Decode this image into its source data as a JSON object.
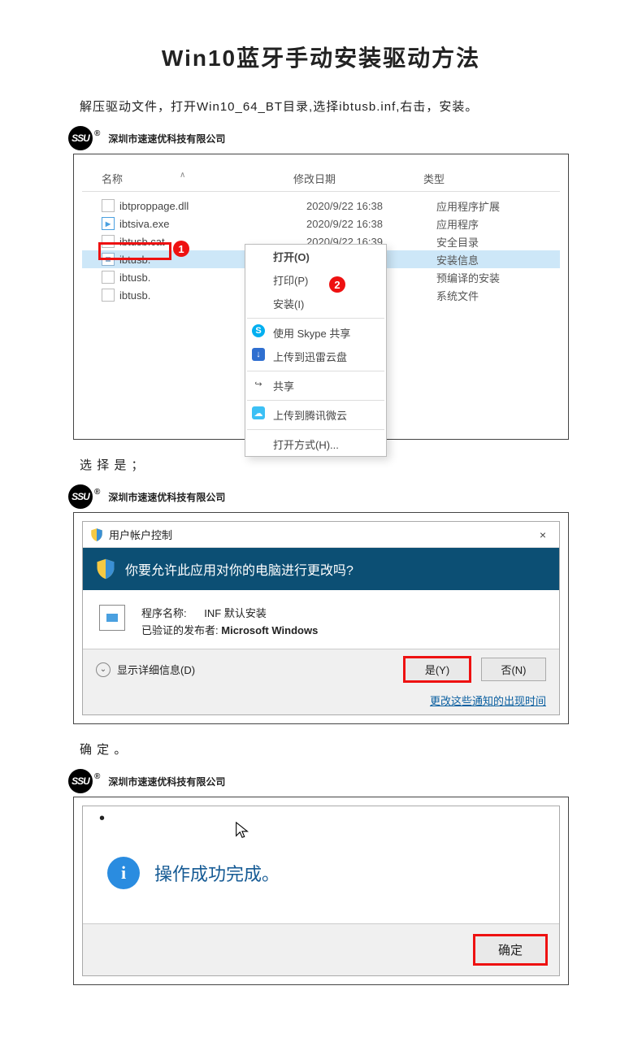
{
  "title": "Win10蓝牙手动安装驱动方法",
  "intro": "解压驱动文件，打开Win10_64_BT目录,选择ibtusb.inf,右击，安装。",
  "watermark": {
    "logo": "SSU",
    "company": "深圳市速速优科技有限公司",
    "reg": "®"
  },
  "explorer": {
    "columns": {
      "name": "名称",
      "date": "修改日期",
      "type": "类型"
    },
    "files": [
      {
        "name": "ibtproppage.dll",
        "date": "2020/9/22 16:38",
        "type": "应用程序扩展"
      },
      {
        "name": "ibtsiva.exe",
        "date": "2020/9/22 16:38",
        "type": "应用程序"
      },
      {
        "name": "ibtusb.cat",
        "date": "2020/9/22 16:39",
        "type": "安全目录"
      },
      {
        "name": "ibtusb.",
        "date": "",
        "type": "安装信息",
        "selected": true
      },
      {
        "name": "ibtusb.",
        "date": "",
        "type": "预编译的安装"
      },
      {
        "name": "ibtusb.",
        "date": "",
        "type": "系统文件"
      }
    ],
    "markers": {
      "one": "1",
      "two": "2"
    },
    "menu": {
      "open": "打开(O)",
      "print": "打印(P)",
      "install": "安装(I)",
      "skype": "使用 Skype 共享",
      "xunlei": "上传到迅雷云盘",
      "share": "共享",
      "weiyun": "上传到腾讯微云",
      "openwith": "打开方式(H)..."
    }
  },
  "step2": "选 择 是 ；",
  "uac": {
    "title": "用户帐户控制",
    "close": "×",
    "banner": "你要允许此应用对你的电脑进行更改吗?",
    "label_program": "程序名称:",
    "program": "INF 默认安装",
    "label_publisher": "已验证的发布者:",
    "publisher": "Microsoft Windows",
    "details": "显示详细信息(D)",
    "yes": "是(Y)",
    "no": "否(N)",
    "settings_link": "更改这些通知的出现时间"
  },
  "step3": "确 定 。",
  "okdlg": {
    "msg": "操作成功完成。",
    "ok": "确定"
  }
}
